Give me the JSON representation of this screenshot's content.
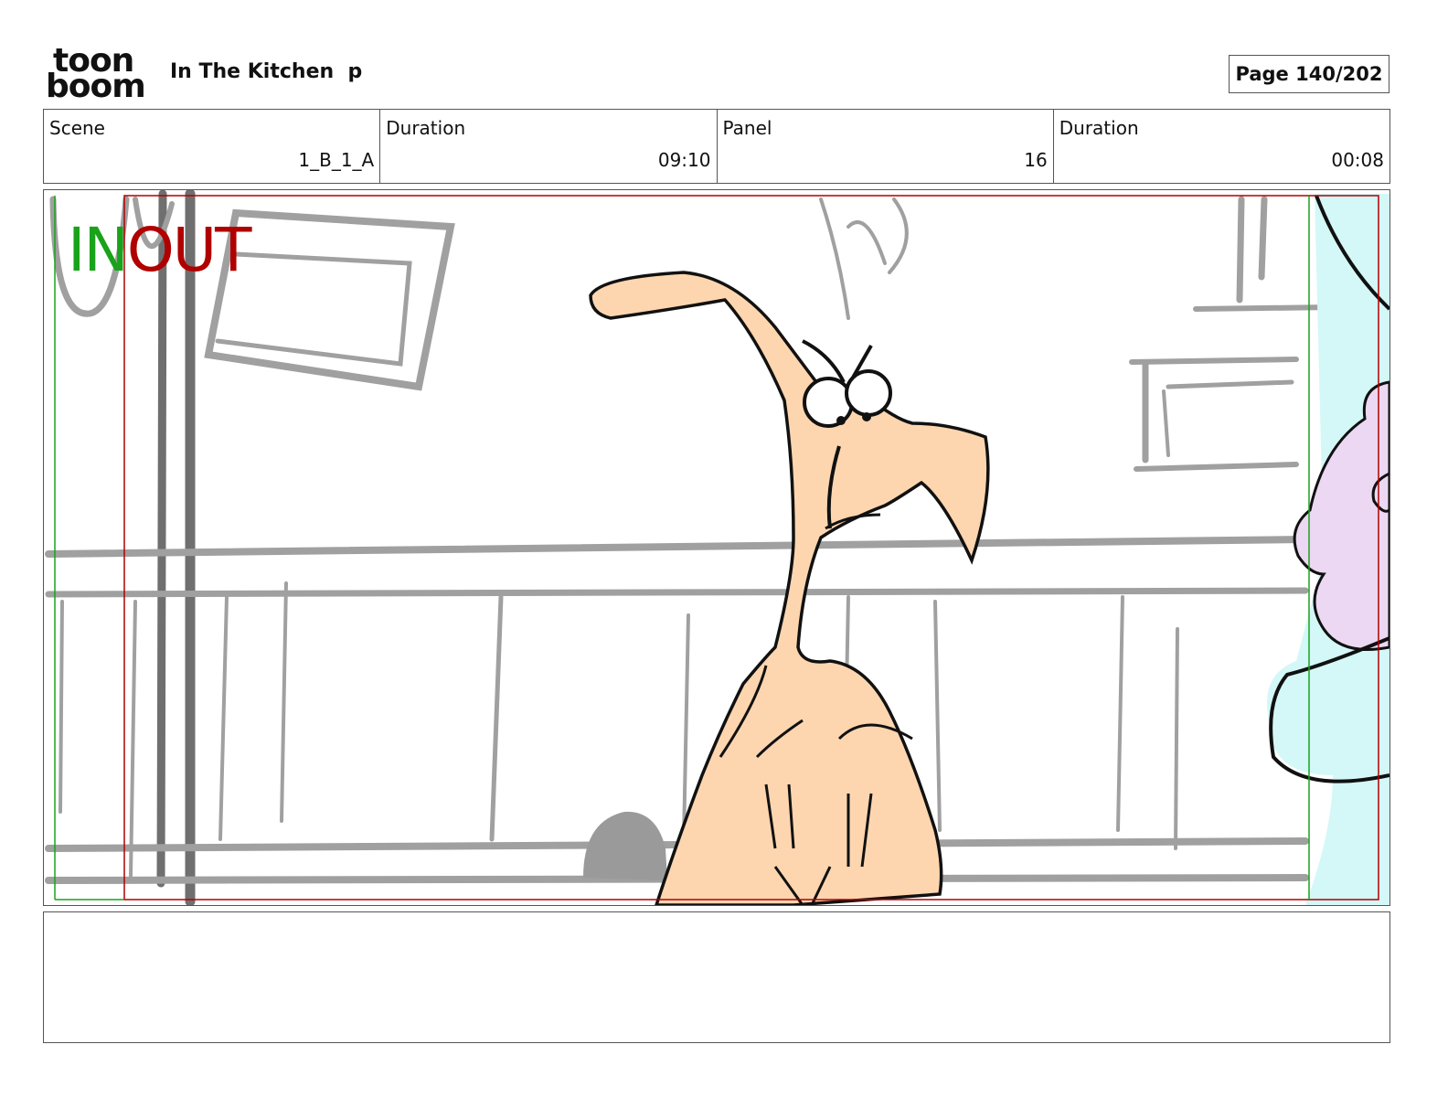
{
  "header": {
    "logo_top": "toon",
    "logo_bottom": "boom",
    "title": "In The Kitchen  p",
    "page_label": "Page 140/202"
  },
  "info": {
    "scene_label": "Scene",
    "scene_value": "1_B_1_A",
    "duration_label": "Duration",
    "duration_value": "09:10",
    "panel_label": "Panel",
    "panel_value": "16",
    "panel_duration_label": "Duration",
    "panel_duration_value": "00:08"
  },
  "panel": {
    "in_label": "IN",
    "out_label": "OUT",
    "colors": {
      "in": "#1aa31a",
      "out": "#b00000",
      "skin": "#fdd6b0",
      "background_lines": "#a0a0a0",
      "purple_character": "#ecd8f2",
      "cyan_character": "#d4f8f8"
    }
  },
  "notes": {
    "text": ""
  }
}
